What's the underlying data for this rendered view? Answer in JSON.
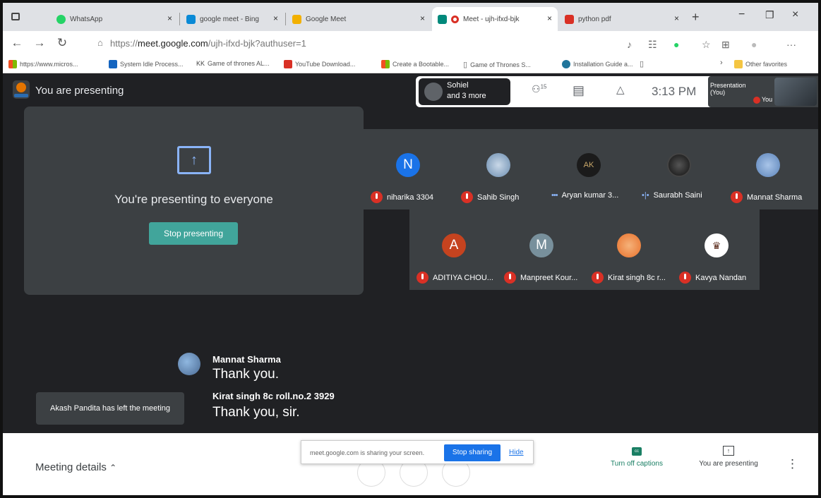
{
  "browser": {
    "tabs": [
      {
        "title": "WhatsApp",
        "icon": "whatsapp-icon",
        "color": "#25d366"
      },
      {
        "title": "google meet - Bing",
        "icon": "bing-icon",
        "color": "#0a8ad6"
      },
      {
        "title": "Google Meet",
        "icon": "google-meet-icon",
        "color": "#f2b000"
      },
      {
        "title": "Meet - ujh-ifxd-bjk",
        "icon": "google-meet-icon",
        "color": "#00897b"
      },
      {
        "title": "python pdf",
        "icon": "pdf-icon",
        "color": "#d93025"
      }
    ],
    "new_tab": "+",
    "url_prefix": "https://",
    "url_host": "meet.google.com",
    "url_path": "/ujh-ifxd-bjk?authuser=1",
    "bookmarks": [
      "https://www.micros...",
      "System Idle Process...",
      "Game of thrones AL...",
      "YouTube Download...",
      "Create a Bootable...",
      "Game of Thrones S...",
      "Installation Guide a..."
    ],
    "other_favorites": "Other favorites"
  },
  "meet": {
    "presenting_banner": "You are presenting",
    "people": {
      "line1": "Sohiel",
      "line2": "and 3 more"
    },
    "participant_count": "15",
    "time": "3:13 PM",
    "self_tile": {
      "label_line1": "Presentation",
      "label_line2": "(You)",
      "you": "You"
    },
    "present_tile": {
      "text": "You're presenting to everyone",
      "stop_label": "Stop presenting"
    },
    "participants_row1": [
      {
        "name": "niharika 3304",
        "initial": "N",
        "avatar_color": "#1a73e8",
        "status": "muted"
      },
      {
        "name": "Sahib Singh",
        "initial": "",
        "avatar_color": "#6a8caf",
        "status": "muted"
      },
      {
        "name": "Aryan kumar 3...",
        "initial": "",
        "avatar_color": "#1b1b1b",
        "status": "connecting"
      },
      {
        "name": "Saurabh Saini",
        "initial": "",
        "avatar_color": "#2a2a2a",
        "status": "speaking"
      },
      {
        "name": "Mannat Sharma",
        "initial": "",
        "avatar_color": "#5b83b9",
        "status": "muted"
      }
    ],
    "participants_row2": [
      {
        "name": "ADITIYA CHOU...",
        "initial": "A",
        "avatar_color": "#c5431f",
        "status": "muted"
      },
      {
        "name": "Manpreet Kour...",
        "initial": "M",
        "avatar_color": "#78909c",
        "status": "muted"
      },
      {
        "name": "Kirat singh 8c r...",
        "initial": "",
        "avatar_color": "#e8702a",
        "status": "muted"
      },
      {
        "name": "Kavya Nandan",
        "initial": "",
        "avatar_color": "#ffffff",
        "status": "muted"
      }
    ],
    "captions": [
      {
        "speaker": "Mannat Sharma",
        "text": "Thank you."
      },
      {
        "speaker": "Kirat singh 8c roll.no.2 3929",
        "text": "Thank you, sir."
      }
    ],
    "left_message": "Akash Pandita has left the meeting"
  },
  "bottom": {
    "meeting_details": "Meeting details",
    "share_message": "meet.google.com is sharing your screen.",
    "stop_sharing": "Stop sharing",
    "hide": "Hide",
    "captions_label": "Turn off captions",
    "captions_icon": "cc",
    "presenting_label": "You are presenting"
  },
  "colors": {
    "meet_bg": "#202124",
    "tile_bg": "#3c4043",
    "accent": "#41a59b",
    "muted": "#d93025",
    "link": "#1a73e8"
  }
}
